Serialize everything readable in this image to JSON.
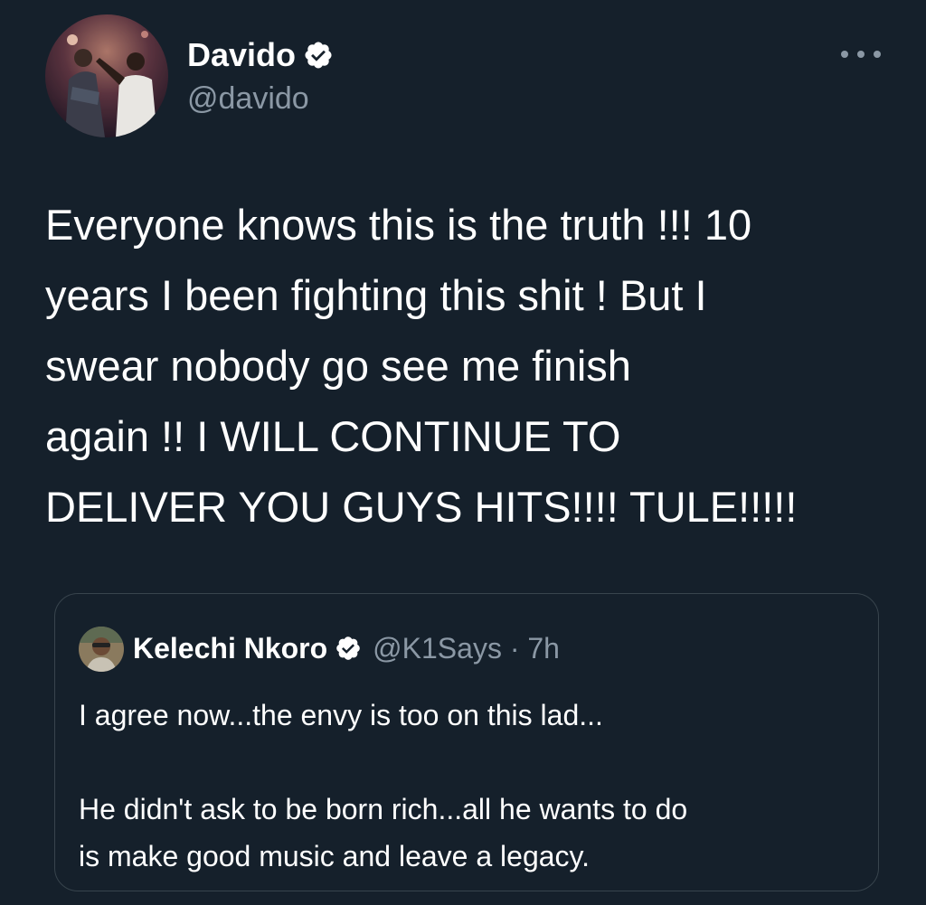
{
  "tweet": {
    "author": {
      "display_name": "Davido",
      "handle": "@davido",
      "verified": true
    },
    "text": "Everyone knows this is the truth !!! 10\nyears I been fighting this shit !  But I\nswear nobody go see me finish\nagain !! I WILL CONTINUE TO\nDELIVER YOU GUYS HITS!!!! TULE!!!!!"
  },
  "quoted_tweet": {
    "author": {
      "display_name": "Kelechi Nkoro",
      "handle": "@K1Says",
      "verified": true
    },
    "separator": " · ",
    "time": "7h",
    "text": "I agree now...the envy is too on this lad...\n\nHe didn't ask to be born rich...all he wants to do\nis make good music and leave a legacy."
  },
  "icons": {
    "verified": "verified-badge-icon",
    "more": "more-options-icon"
  },
  "colors": {
    "background": "#15202b",
    "text": "#ffffff",
    "secondary_text": "#8b98a5",
    "border": "#38444d"
  }
}
